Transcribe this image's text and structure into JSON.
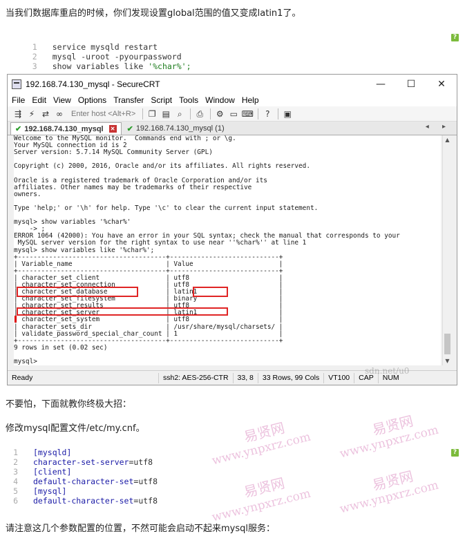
{
  "paragraphs": {
    "intro": "当我们数据库重启的时候，你们发现设置global范围的值又变成latin1了。",
    "tip": "不要怕，下面就教你终极大招：",
    "modify": "修改mysql配置文件/etc/my.cnf。",
    "note": "请注意这几个参数配置的位置，不然可能会启动不起来mysql服务："
  },
  "code_block_1": {
    "help_label": "?",
    "lines": [
      {
        "n": "1",
        "plain": "service mysqld restart",
        "str": ""
      },
      {
        "n": "2",
        "plain": "mysql -uroot -pyourpassword",
        "str": ""
      },
      {
        "n": "3",
        "plain": "show variables like ",
        "str": "'%char%';"
      }
    ]
  },
  "code_block_2": {
    "help_label": "?",
    "lines": [
      {
        "n": "1",
        "a": "[mysqld]",
        "b": ""
      },
      {
        "n": "2",
        "a": "character-set-server",
        "b": "=utf8"
      },
      {
        "n": "3",
        "a": "[client]",
        "b": ""
      },
      {
        "n": "4",
        "a": "default-character-set",
        "b": "=utf8"
      },
      {
        "n": "5",
        "a": "[mysql]",
        "b": ""
      },
      {
        "n": "6",
        "a": "default-character-set",
        "b": "=utf8"
      }
    ]
  },
  "crt": {
    "title": "192.168.74.130_mysql - SecureCRT",
    "window_controls": {
      "minimize": "—",
      "maximize": "☐",
      "close": "✕"
    },
    "menu": [
      "File",
      "Edit",
      "View",
      "Options",
      "Transfer",
      "Script",
      "Tools",
      "Window",
      "Help"
    ],
    "host_placeholder": "Enter host <Alt+R>",
    "tabs": [
      {
        "label": "192.168.74.130_mysql",
        "active": true
      },
      {
        "label": "192.168.74.130_mysql (1)",
        "active": false
      }
    ],
    "tab_arrows": "◂ ▸",
    "terminal_lines": [
      "Welcome to the MySQL monitor.  Commands end with ; or \\g.",
      "Your MySQL connection id is 2",
      "Server version: 5.7.14 MySQL Community Server (GPL)",
      "",
      "Copyright (c) 2000, 2016, Oracle and/or its affiliates. All rights reserved.",
      "",
      "Oracle is a registered trademark of Oracle Corporation and/or its",
      "affiliates. Other names may be trademarks of their respective",
      "owners.",
      "",
      "Type 'help;' or '\\h' for help. Type '\\c' to clear the current input statement.",
      "",
      "mysql> show variables '%char%'",
      "    -> ;",
      "ERROR 1064 (42000): You have an error in your SQL syntax; check the manual that corresponds to your",
      " MySQL server version for the right syntax to use near ''%char%'' at line 1",
      "mysql> show variables like '%char%';",
      "+--------------------------------------+----------------------------+",
      "| Variable_name                        | Value                      |",
      "+--------------------------------------+----------------------------+",
      "| character_set_client                 | utf8                       |",
      "| character_set_connection             | utf8                       |",
      "| character_set_database               | latin1                     |",
      "| character_set_filesystem             | binary                     |",
      "| character_set_results                | utf8                       |",
      "| character_set_server                 | latin1                     |",
      "| character_set_system                 | utf8                       |",
      "| character_sets_dir                   | /usr/share/mysql/charsets/ |",
      "| validate_password_special_char_count | 1                          |",
      "+--------------------------------------+----------------------------+",
      "9 rows in set (0.02 sec)",
      "",
      "mysql>"
    ],
    "status": {
      "ready": "Ready",
      "cipher": "ssh2: AES-256-CTR",
      "position": "33,  8",
      "size": "33 Rows, 99 Cols",
      "term": "VT100",
      "cap": "CAP",
      "num": "NUM"
    }
  },
  "watermarks": {
    "cn": "易贤网",
    "url": "www.ynpxrz.com",
    "faint_url": "sdn.net/u0"
  },
  "colors": {
    "highlight_box": "#e02424",
    "keyword": "#1a1aa6",
    "string": "#1a7a1a",
    "help_badge": "#7cbb3c"
  }
}
